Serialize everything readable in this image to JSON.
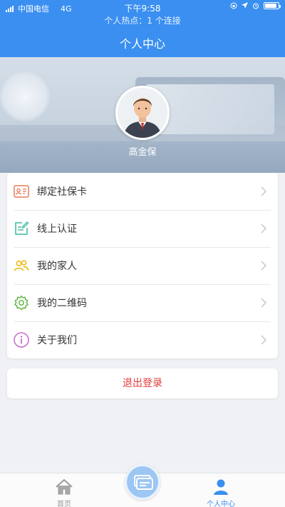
{
  "status_bar": {
    "carrier": "中国电信",
    "network": "4G",
    "time": "下午9:58",
    "hotspot": "个人热点：1 个连接"
  },
  "nav": {
    "title": "个人中心"
  },
  "profile": {
    "name": "高金保",
    "avatar_icon": "user-avatar"
  },
  "menu": {
    "items": [
      {
        "label": "绑定社保卡",
        "icon": "id-card-icon",
        "color": "#e67b5a"
      },
      {
        "label": "线上认证",
        "icon": "edit-doc-icon",
        "color": "#3cb8a0"
      },
      {
        "label": "我的家人",
        "icon": "family-icon",
        "color": "#f0b400"
      },
      {
        "label": "我的二维码",
        "icon": "gear-qr-icon",
        "color": "#58b43a"
      },
      {
        "label": "关于我们",
        "icon": "info-icon",
        "color": "#c86ad0"
      }
    ]
  },
  "logout": {
    "label": "退出登录"
  },
  "tabbar": {
    "home_label": "首页",
    "me_label": "个人中心",
    "accent": "#3a8ff0"
  }
}
